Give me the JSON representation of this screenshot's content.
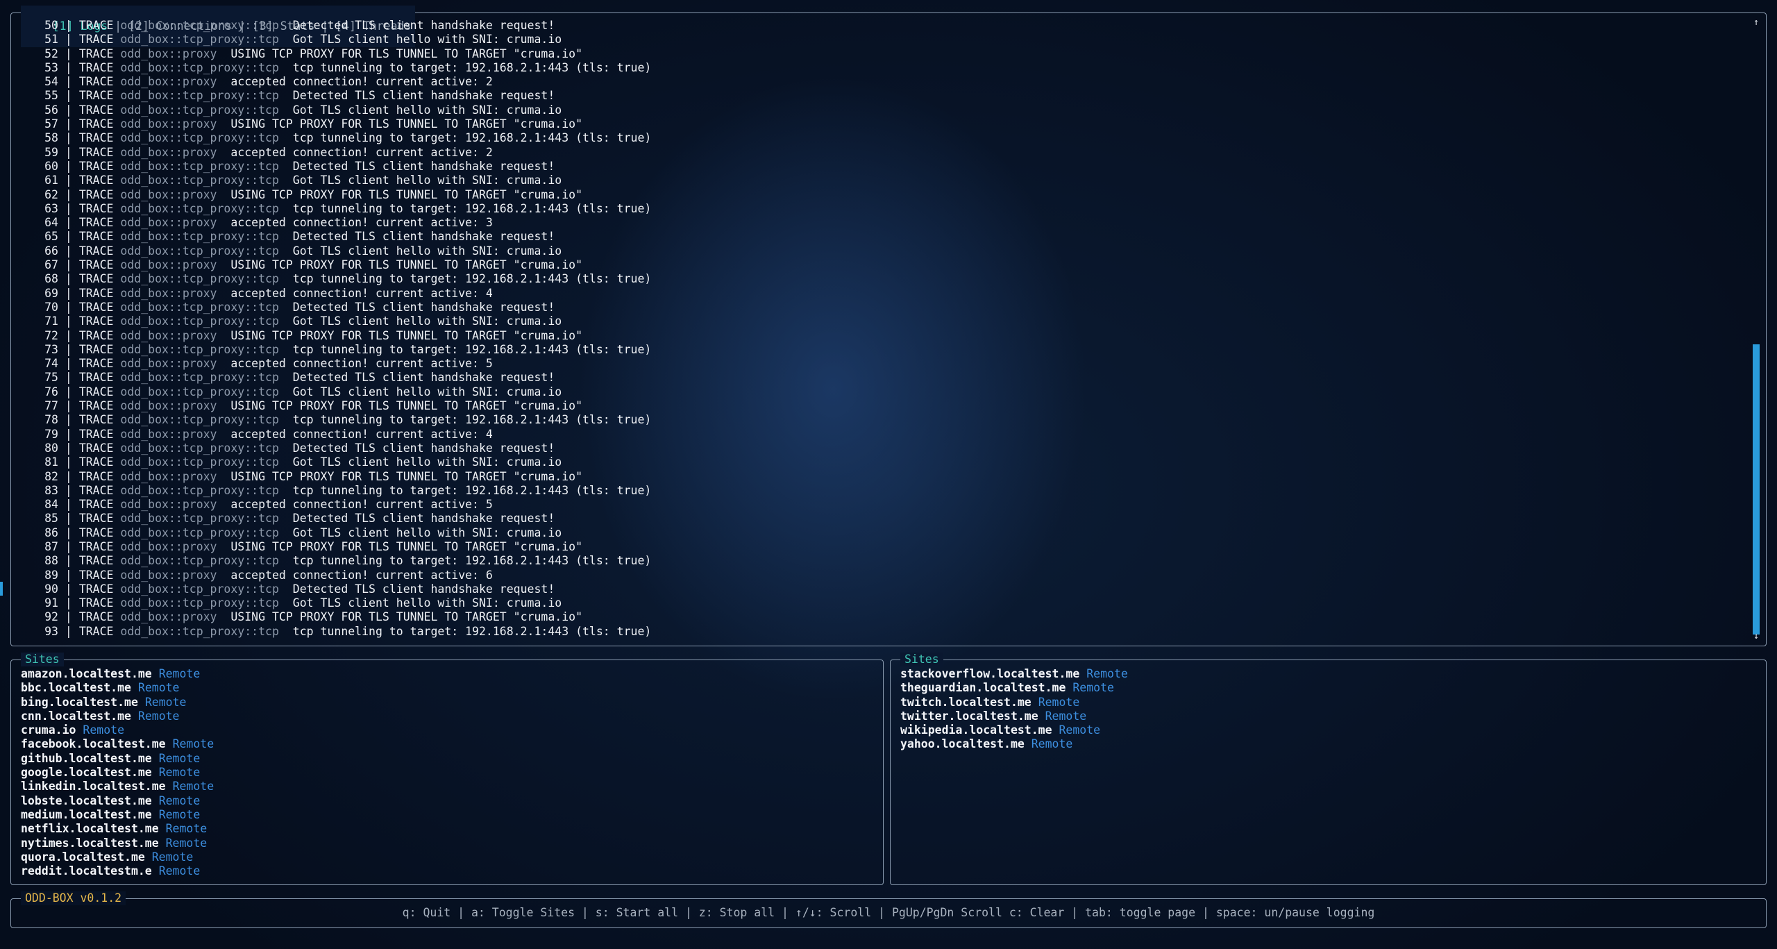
{
  "tabs": [
    {
      "label": "[1] Logs",
      "active": true
    },
    {
      "label": "[2] Connections",
      "active": false
    },
    {
      "label": "[3] Stats",
      "active": false
    },
    {
      "label": "[4] Threads",
      "active": false
    }
  ],
  "logs": [
    {
      "n": "50",
      "level": "TRACE",
      "module": "odd_box::tcp_proxy::tcp",
      "msg": "Detected TLS client handshake request!"
    },
    {
      "n": "51",
      "level": "TRACE",
      "module": "odd_box::tcp_proxy::tcp",
      "msg": "Got TLS client hello with SNI: cruma.io"
    },
    {
      "n": "52",
      "level": "TRACE",
      "module": "odd_box::proxy",
      "msg": "USING TCP PROXY FOR TLS TUNNEL TO TARGET \"cruma.io\""
    },
    {
      "n": "53",
      "level": "TRACE",
      "module": "odd_box::tcp_proxy::tcp",
      "msg": "tcp tunneling to target: 192.168.2.1:443 (tls: true)"
    },
    {
      "n": "54",
      "level": "TRACE",
      "module": "odd_box::proxy",
      "msg": "accepted connection! current active: 2"
    },
    {
      "n": "55",
      "level": "TRACE",
      "module": "odd_box::tcp_proxy::tcp",
      "msg": "Detected TLS client handshake request!"
    },
    {
      "n": "56",
      "level": "TRACE",
      "module": "odd_box::tcp_proxy::tcp",
      "msg": "Got TLS client hello with SNI: cruma.io"
    },
    {
      "n": "57",
      "level": "TRACE",
      "module": "odd_box::proxy",
      "msg": "USING TCP PROXY FOR TLS TUNNEL TO TARGET \"cruma.io\""
    },
    {
      "n": "58",
      "level": "TRACE",
      "module": "odd_box::tcp_proxy::tcp",
      "msg": "tcp tunneling to target: 192.168.2.1:443 (tls: true)"
    },
    {
      "n": "59",
      "level": "TRACE",
      "module": "odd_box::proxy",
      "msg": "accepted connection! current active: 2"
    },
    {
      "n": "60",
      "level": "TRACE",
      "module": "odd_box::tcp_proxy::tcp",
      "msg": "Detected TLS client handshake request!"
    },
    {
      "n": "61",
      "level": "TRACE",
      "module": "odd_box::tcp_proxy::tcp",
      "msg": "Got TLS client hello with SNI: cruma.io"
    },
    {
      "n": "62",
      "level": "TRACE",
      "module": "odd_box::proxy",
      "msg": "USING TCP PROXY FOR TLS TUNNEL TO TARGET \"cruma.io\""
    },
    {
      "n": "63",
      "level": "TRACE",
      "module": "odd_box::tcp_proxy::tcp",
      "msg": "tcp tunneling to target: 192.168.2.1:443 (tls: true)"
    },
    {
      "n": "64",
      "level": "TRACE",
      "module": "odd_box::proxy",
      "msg": "accepted connection! current active: 3"
    },
    {
      "n": "65",
      "level": "TRACE",
      "module": "odd_box::tcp_proxy::tcp",
      "msg": "Detected TLS client handshake request!"
    },
    {
      "n": "66",
      "level": "TRACE",
      "module": "odd_box::tcp_proxy::tcp",
      "msg": "Got TLS client hello with SNI: cruma.io"
    },
    {
      "n": "67",
      "level": "TRACE",
      "module": "odd_box::proxy",
      "msg": "USING TCP PROXY FOR TLS TUNNEL TO TARGET \"cruma.io\""
    },
    {
      "n": "68",
      "level": "TRACE",
      "module": "odd_box::tcp_proxy::tcp",
      "msg": "tcp tunneling to target: 192.168.2.1:443 (tls: true)"
    },
    {
      "n": "69",
      "level": "TRACE",
      "module": "odd_box::proxy",
      "msg": "accepted connection! current active: 4"
    },
    {
      "n": "70",
      "level": "TRACE",
      "module": "odd_box::tcp_proxy::tcp",
      "msg": "Detected TLS client handshake request!"
    },
    {
      "n": "71",
      "level": "TRACE",
      "module": "odd_box::tcp_proxy::tcp",
      "msg": "Got TLS client hello with SNI: cruma.io"
    },
    {
      "n": "72",
      "level": "TRACE",
      "module": "odd_box::proxy",
      "msg": "USING TCP PROXY FOR TLS TUNNEL TO TARGET \"cruma.io\""
    },
    {
      "n": "73",
      "level": "TRACE",
      "module": "odd_box::tcp_proxy::tcp",
      "msg": "tcp tunneling to target: 192.168.2.1:443 (tls: true)"
    },
    {
      "n": "74",
      "level": "TRACE",
      "module": "odd_box::proxy",
      "msg": "accepted connection! current active: 5"
    },
    {
      "n": "75",
      "level": "TRACE",
      "module": "odd_box::tcp_proxy::tcp",
      "msg": "Detected TLS client handshake request!"
    },
    {
      "n": "76",
      "level": "TRACE",
      "module": "odd_box::tcp_proxy::tcp",
      "msg": "Got TLS client hello with SNI: cruma.io"
    },
    {
      "n": "77",
      "level": "TRACE",
      "module": "odd_box::proxy",
      "msg": "USING TCP PROXY FOR TLS TUNNEL TO TARGET \"cruma.io\""
    },
    {
      "n": "78",
      "level": "TRACE",
      "module": "odd_box::tcp_proxy::tcp",
      "msg": "tcp tunneling to target: 192.168.2.1:443 (tls: true)"
    },
    {
      "n": "79",
      "level": "TRACE",
      "module": "odd_box::proxy",
      "msg": "accepted connection! current active: 4"
    },
    {
      "n": "80",
      "level": "TRACE",
      "module": "odd_box::tcp_proxy::tcp",
      "msg": "Detected TLS client handshake request!"
    },
    {
      "n": "81",
      "level": "TRACE",
      "module": "odd_box::tcp_proxy::tcp",
      "msg": "Got TLS client hello with SNI: cruma.io"
    },
    {
      "n": "82",
      "level": "TRACE",
      "module": "odd_box::proxy",
      "msg": "USING TCP PROXY FOR TLS TUNNEL TO TARGET \"cruma.io\""
    },
    {
      "n": "83",
      "level": "TRACE",
      "module": "odd_box::tcp_proxy::tcp",
      "msg": "tcp tunneling to target: 192.168.2.1:443 (tls: true)"
    },
    {
      "n": "84",
      "level": "TRACE",
      "module": "odd_box::proxy",
      "msg": "accepted connection! current active: 5"
    },
    {
      "n": "85",
      "level": "TRACE",
      "module": "odd_box::tcp_proxy::tcp",
      "msg": "Detected TLS client handshake request!"
    },
    {
      "n": "86",
      "level": "TRACE",
      "module": "odd_box::tcp_proxy::tcp",
      "msg": "Got TLS client hello with SNI: cruma.io"
    },
    {
      "n": "87",
      "level": "TRACE",
      "module": "odd_box::proxy",
      "msg": "USING TCP PROXY FOR TLS TUNNEL TO TARGET \"cruma.io\""
    },
    {
      "n": "88",
      "level": "TRACE",
      "module": "odd_box::tcp_proxy::tcp",
      "msg": "tcp tunneling to target: 192.168.2.1:443 (tls: true)"
    },
    {
      "n": "89",
      "level": "TRACE",
      "module": "odd_box::proxy",
      "msg": "accepted connection! current active: 6"
    },
    {
      "n": "90",
      "level": "TRACE",
      "module": "odd_box::tcp_proxy::tcp",
      "msg": "Detected TLS client handshake request!"
    },
    {
      "n": "91",
      "level": "TRACE",
      "module": "odd_box::tcp_proxy::tcp",
      "msg": "Got TLS client hello with SNI: cruma.io"
    },
    {
      "n": "92",
      "level": "TRACE",
      "module": "odd_box::proxy",
      "msg": "USING TCP PROXY FOR TLS TUNNEL TO TARGET \"cruma.io\""
    },
    {
      "n": "93",
      "level": "TRACE",
      "module": "odd_box::tcp_proxy::tcp",
      "msg": "tcp tunneling to target: 192.168.2.1:443 (tls: true)"
    }
  ],
  "scroll": {
    "up": "↑",
    "down": "↓"
  },
  "sites_left": {
    "title": "Sites",
    "items": [
      {
        "name": "amazon.localtest.me",
        "type": "Remote"
      },
      {
        "name": "bbc.localtest.me",
        "type": "Remote"
      },
      {
        "name": "bing.localtest.me",
        "type": "Remote"
      },
      {
        "name": "cnn.localtest.me",
        "type": "Remote"
      },
      {
        "name": "cruma.io",
        "type": "Remote"
      },
      {
        "name": "facebook.localtest.me",
        "type": "Remote"
      },
      {
        "name": "github.localtest.me",
        "type": "Remote"
      },
      {
        "name": "google.localtest.me",
        "type": "Remote"
      },
      {
        "name": "linkedin.localtest.me",
        "type": "Remote"
      },
      {
        "name": "lobste.localtest.me",
        "type": "Remote"
      },
      {
        "name": "medium.localtest.me",
        "type": "Remote"
      },
      {
        "name": "netflix.localtest.me",
        "type": "Remote"
      },
      {
        "name": "nytimes.localtest.me",
        "type": "Remote"
      },
      {
        "name": "quora.localtest.me",
        "type": "Remote"
      },
      {
        "name": "reddit.localtestm.e",
        "type": "Remote"
      }
    ]
  },
  "sites_right": {
    "title": "Sites",
    "items": [
      {
        "name": "stackoverflow.localtest.me",
        "type": "Remote"
      },
      {
        "name": "theguardian.localtest.me",
        "type": "Remote"
      },
      {
        "name": "twitch.localtest.me",
        "type": "Remote"
      },
      {
        "name": "twitter.localtest.me",
        "type": "Remote"
      },
      {
        "name": "wikipedia.localtest.me",
        "type": "Remote"
      },
      {
        "name": "yahoo.localtest.me",
        "type": "Remote"
      }
    ]
  },
  "footer": {
    "title": "ODD-BOX v0.1.2",
    "help": "q: Quit | a: Toggle Sites | s: Start all | z: Stop all | ↑/↓: Scroll | PgUp/PgDn Scroll c: Clear | tab: toggle page | space: un/pause logging"
  },
  "colors": {
    "accent": "#3fc5b5",
    "remote": "#3d8fe0",
    "scrollbar": "#2a9bdb",
    "footer_title": "#e4b64a",
    "border": "#8a9bb0"
  }
}
